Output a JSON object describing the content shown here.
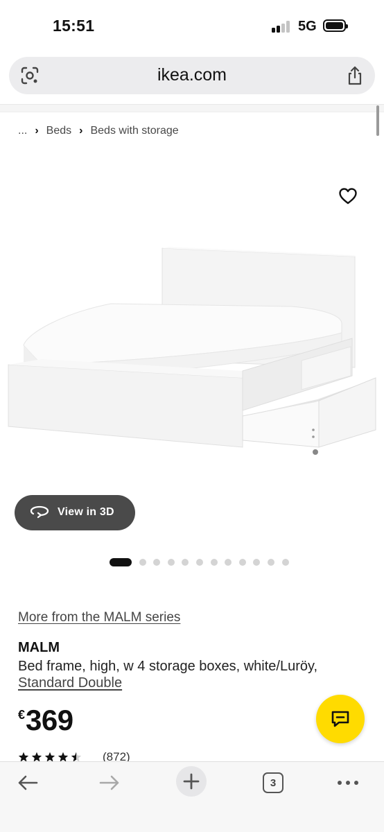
{
  "status_bar": {
    "time": "15:51",
    "network": "5G",
    "icons": [
      "signal-icon",
      "battery-icon"
    ]
  },
  "browser": {
    "url": "ikea.com",
    "icons": [
      "lens-icon",
      "share-icon"
    ]
  },
  "breadcrumb": {
    "items": [
      "...",
      "Beds",
      "Beds with storage"
    ]
  },
  "gallery": {
    "view_3d_label": "View in 3D",
    "total_images": 12,
    "active_index": 0,
    "icons": [
      "heart-icon",
      "rotate-3d-icon"
    ]
  },
  "product": {
    "series_link": "More from the MALM series",
    "name": "MALM",
    "description": "Bed frame, high, w 4 storage boxes, white/Luröy,",
    "size": "Standard Double",
    "currency": "€",
    "price": "369",
    "rating": 4.5,
    "review_count": "(872)"
  },
  "chat": {
    "icon": "chat-icon",
    "color": "#ffdb00"
  },
  "toolbar": {
    "tab_count": "3",
    "icons": [
      "back-arrow-icon",
      "forward-arrow-icon",
      "plus-icon",
      "tabs-icon",
      "more-icon"
    ]
  }
}
